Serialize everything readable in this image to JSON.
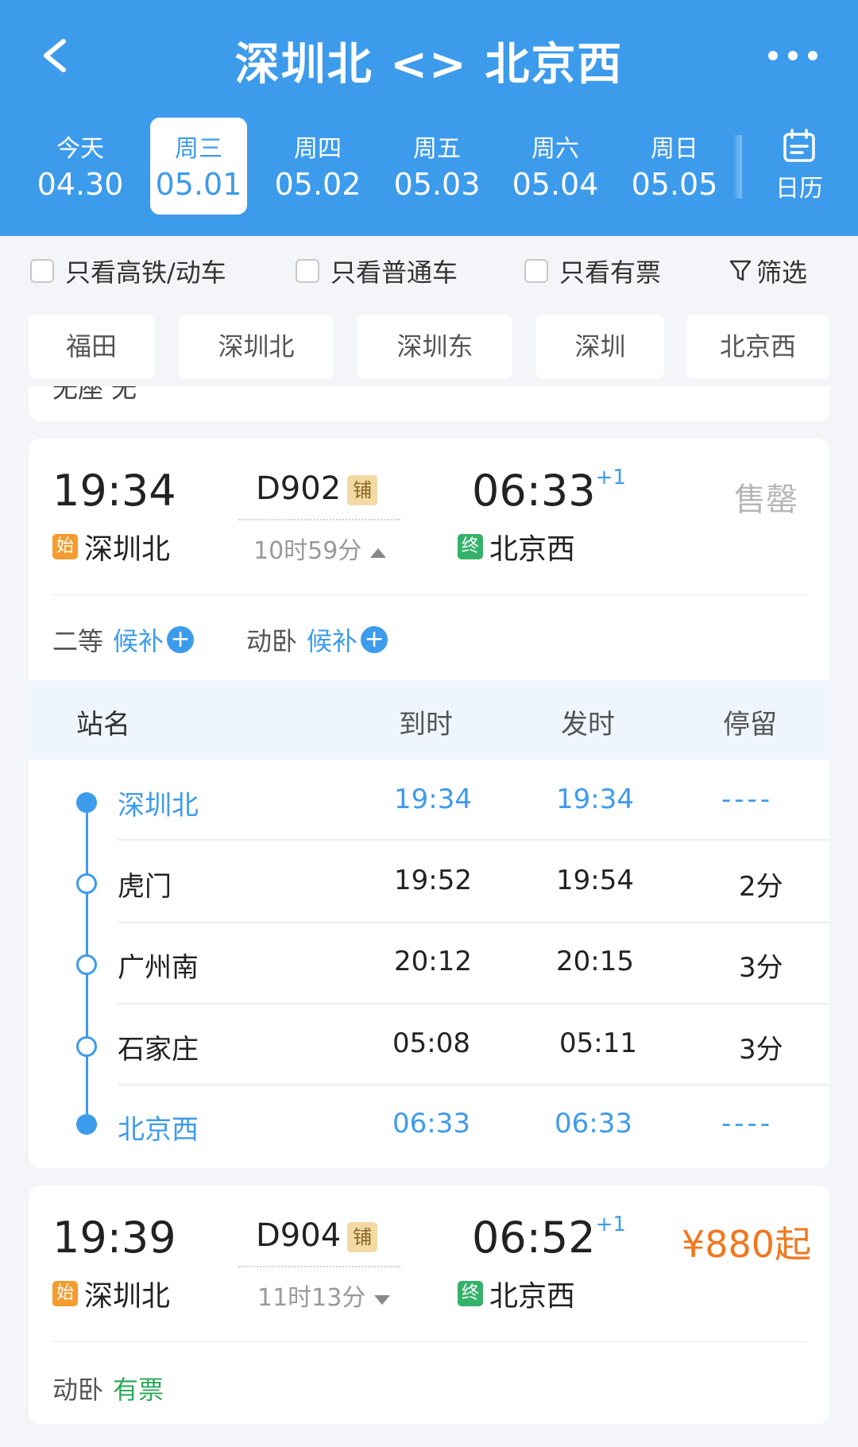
{
  "header": {
    "title": "深圳北 <> 北京西"
  },
  "dates": [
    {
      "weekday": "今天",
      "date": "04.30"
    },
    {
      "weekday": "周三",
      "date": "05.01"
    },
    {
      "weekday": "周四",
      "date": "05.02"
    },
    {
      "weekday": "周五",
      "date": "05.03"
    },
    {
      "weekday": "周六",
      "date": "05.04"
    },
    {
      "weekday": "周日",
      "date": "05.05"
    }
  ],
  "calendar_label": "日历",
  "filters": {
    "high_speed": "只看高铁/动车",
    "normal": "只看普通车",
    "available": "只看有票",
    "filter": "筛选"
  },
  "stations": [
    "福田",
    "深圳北",
    "深圳东",
    "深圳",
    "北京西"
  ],
  "partial_text": "无座 无",
  "train1": {
    "dep_time": "19:34",
    "dep_station": "深圳北",
    "dep_tag": "始",
    "number": "D902",
    "sleeper_tag": "铺",
    "duration": "10时59分",
    "arr_time": "06:33",
    "arr_day": "+1",
    "arr_station": "北京西",
    "arr_tag": "终",
    "status": "售罄",
    "seats": [
      {
        "class": "二等",
        "status": "候补"
      },
      {
        "class": "动卧",
        "status": "候补"
      }
    ],
    "stops_header": {
      "name": "站名",
      "arrive": "到时",
      "depart": "发时",
      "stay": "停留"
    },
    "stops": [
      {
        "name": "深圳北",
        "arrive": "19:34",
        "depart": "19:34",
        "stay": "----"
      },
      {
        "name": "虎门",
        "arrive": "19:52",
        "depart": "19:54",
        "stay": "2分"
      },
      {
        "name": "广州南",
        "arrive": "20:12",
        "depart": "20:15",
        "stay": "3分"
      },
      {
        "name": "石家庄",
        "arrive": "05:08",
        "depart": "05:11",
        "stay": "3分"
      },
      {
        "name": "北京西",
        "arrive": "06:33",
        "depart": "06:33",
        "stay": "----"
      }
    ]
  },
  "train2": {
    "dep_time": "19:39",
    "dep_station": "深圳北",
    "dep_tag": "始",
    "number": "D904",
    "sleeper_tag": "铺",
    "duration": "11时13分",
    "arr_time": "06:52",
    "arr_day": "+1",
    "arr_station": "北京西",
    "arr_tag": "终",
    "price": "¥880起",
    "seats": [
      {
        "class": "动卧",
        "status": "有票"
      }
    ]
  },
  "colors": {
    "primary": "#3d9bec",
    "start_tag": "#f39c2f",
    "end_tag": "#35b26a",
    "price": "#f0781e"
  }
}
